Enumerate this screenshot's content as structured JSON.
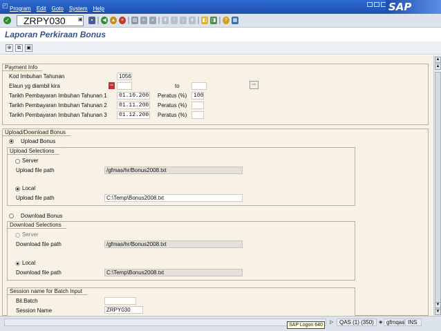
{
  "menu": {
    "items": [
      "Program",
      "Edit",
      "Goto",
      "System",
      "Help"
    ],
    "logo": "SAP"
  },
  "toolbar": {
    "command_field": "ZRPY030"
  },
  "title": "Laporan Perkiraan Bonus",
  "payment_info": {
    "title": "Payment Info",
    "kod_label": "Kod Imbuhan Tahunan",
    "kod_value": "1056",
    "elaun_label": "Elaun yg diambil kira",
    "to_label": "to",
    "rows": [
      {
        "label": "Tarikh Pembayaran Imbuhan Tahunan 1",
        "date": "01.10.2008",
        "peratus_label": "Peratus (%)",
        "peratus": "100"
      },
      {
        "label": "Tarikh Pembayaran Imbuhan Tahunan 2",
        "date": "01.11.2008",
        "peratus_label": "Peratus (%)",
        "peratus": ""
      },
      {
        "label": "Tarikh Pembayaran Imbuhan Tahunan 3",
        "date": "01.12.2008",
        "peratus_label": "Peratus (%)",
        "peratus": ""
      }
    ]
  },
  "upload_download": {
    "title": "Upload/Download Bonus",
    "upload_radio": "Upload Bonus",
    "upload_selections": {
      "title": "Upload Selections",
      "server_label": "Server",
      "server_path_label": "Upload file path",
      "server_path": "/gfmas/hr/Bonus2008.txt",
      "local_label": "Local",
      "local_path_label": "Upload file path",
      "local_path": "C:\\Temp\\Bonus2008.txt"
    },
    "download_radio": "Download Bonus",
    "download_selections": {
      "title": "Download Selections",
      "server_label": "Server",
      "server_path_label": "Download file path",
      "server_path": "/gfmas/hr/Bonus2008.txt",
      "local_label": "Local",
      "local_path_label": "Download file path",
      "local_path": "C:\\Temp\\Bonus2008.txt"
    }
  },
  "session": {
    "title": "Session name for Batch Input",
    "bil_label": "Bil.Batch",
    "bil_value": "",
    "name_label": "Session Name",
    "name_value": "ZRPY030"
  },
  "status": {
    "tooltip": "SAP Logon 640",
    "system": "QAS (1) (350)",
    "server": "gfmqas",
    "mode": "INS"
  }
}
